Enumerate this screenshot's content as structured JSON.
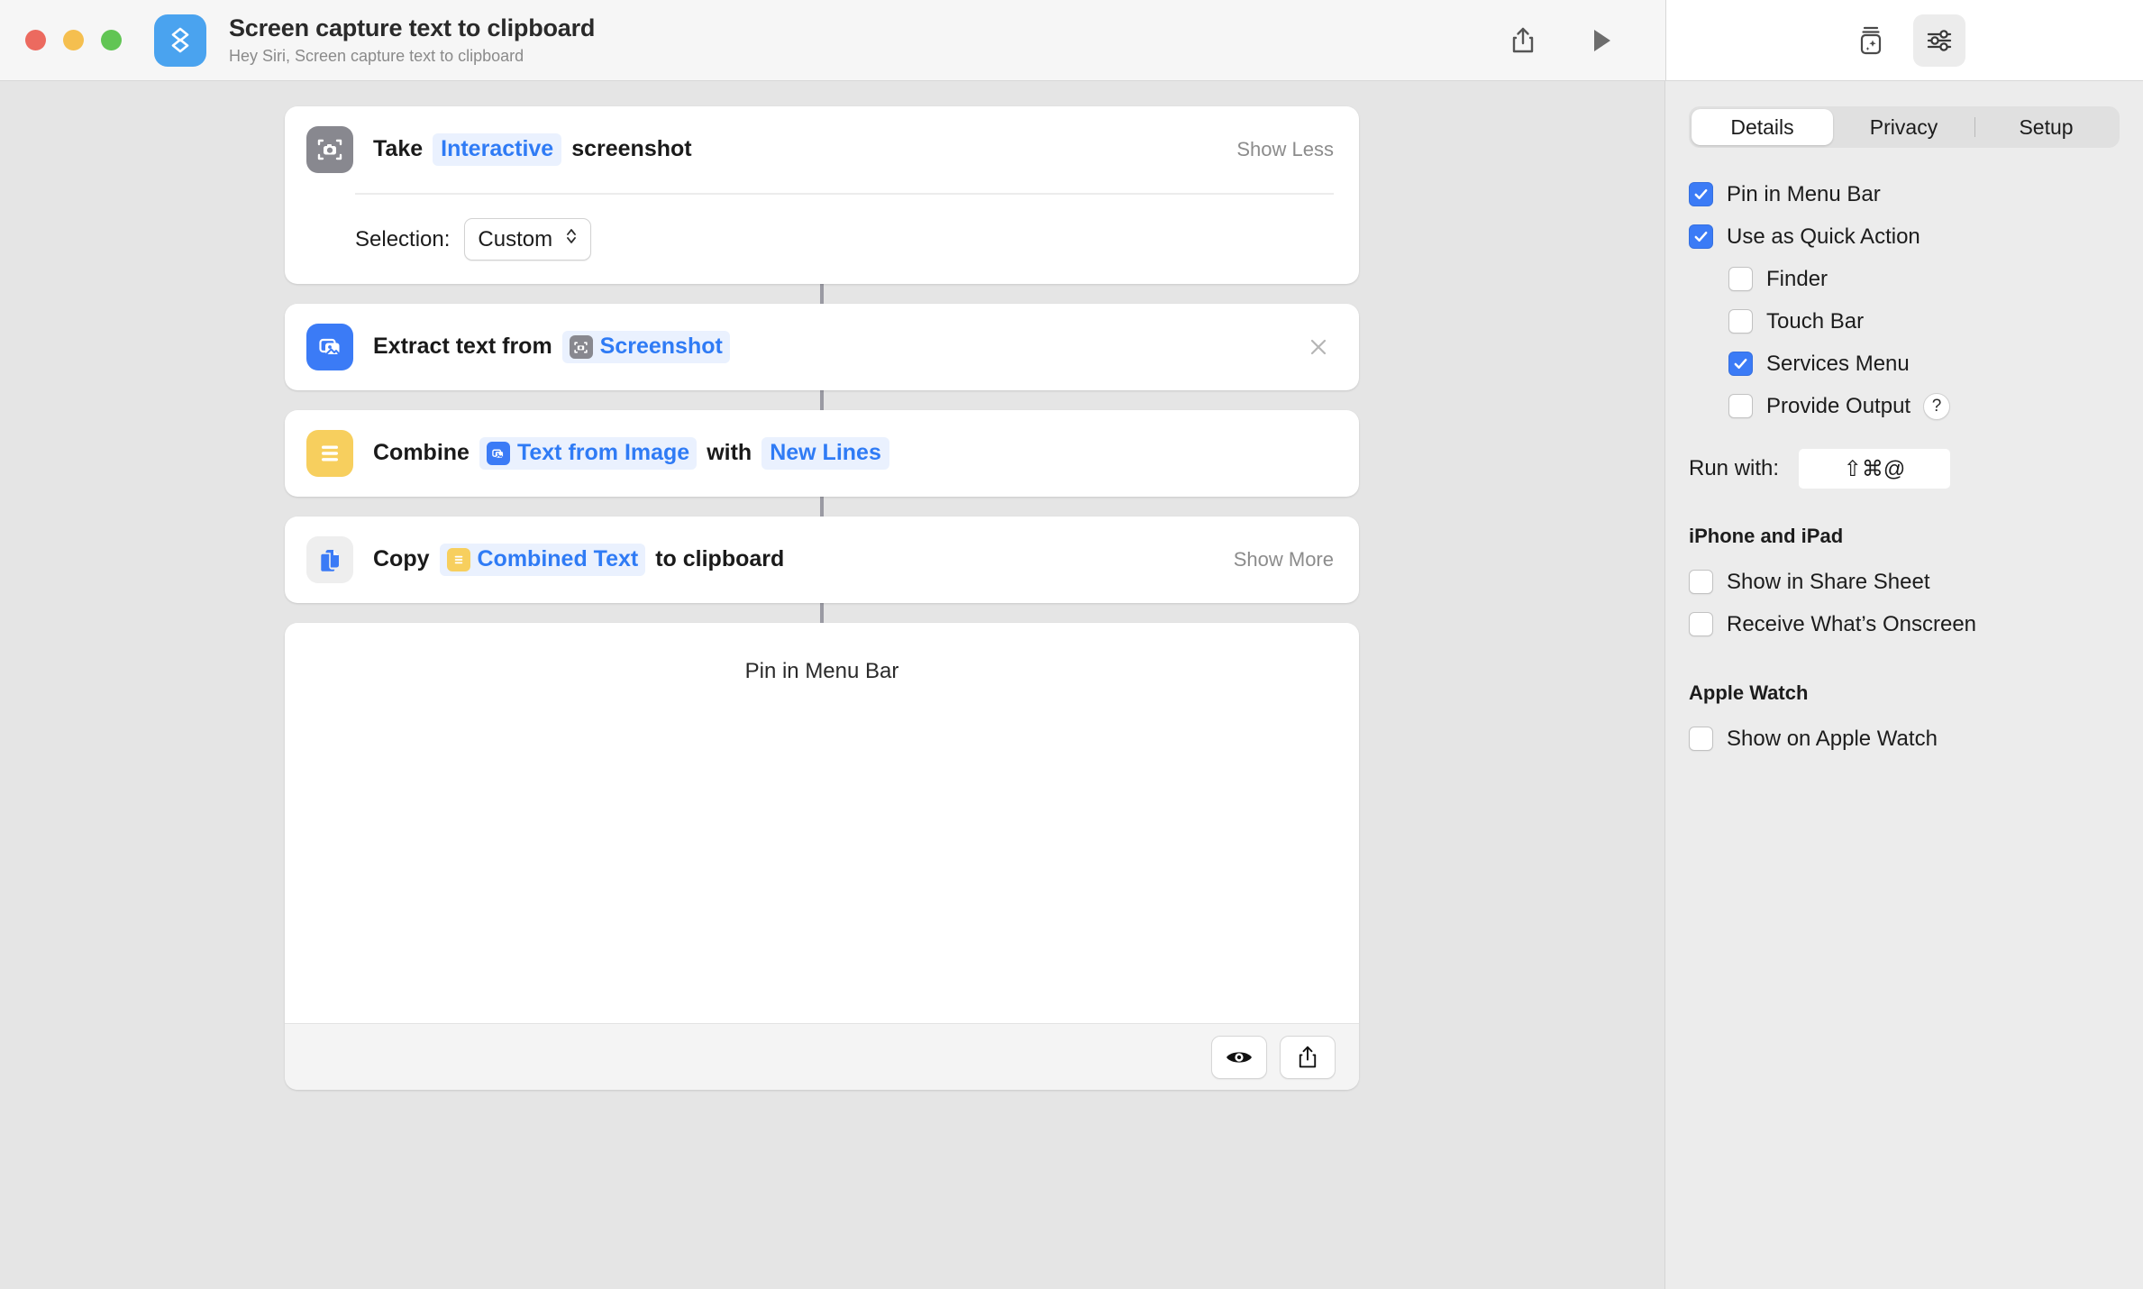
{
  "window": {
    "title": "Screen capture text to clipboard",
    "subtitle": "Hey Siri, Screen capture text to clipboard",
    "app_icon": "shortcuts-icon",
    "accent_blue": "#3b7bf6",
    "token_blue": "#2f7bf5",
    "canvas_bg": "#e5e5e5"
  },
  "toolbar": {
    "share_label": "share-icon",
    "play_label": "play-icon",
    "apps_label": "action-library-icon",
    "inspector_label": "shortcut-details-icon"
  },
  "actions": [
    {
      "icon": "screenshot-camera-icon",
      "icon_color": "#88888f",
      "words": [
        "Take"
      ],
      "token": "Interactive",
      "tail": "screenshot",
      "aux": "Show Less",
      "param_label": "Selection:",
      "param_value": "Custom"
    },
    {
      "icon": "extract-text-photo-icon",
      "icon_color": "#3b7bf6",
      "words": [
        "Extract text from"
      ],
      "token": "Screenshot",
      "token_chip": "screenshot-camera-icon",
      "aux": ""
    },
    {
      "icon": "text-lines-icon",
      "icon_color": "#f7cf5e",
      "words": [
        "Combine"
      ],
      "token": "Text from Image",
      "token_chip": "extract-text-photo-icon",
      "mid": "with",
      "token2": "New Lines",
      "aux": ""
    },
    {
      "icon": "copy-documents-icon",
      "icon_color": "#3b7bf6",
      "words": [
        "Copy"
      ],
      "token": "Combined Text",
      "token_chip": "text-lines-icon",
      "tail": "to clipboard",
      "aux": "Show More"
    }
  ],
  "preview": {
    "text": "Pin in Menu Bar",
    "eye_button": "quick-look-icon",
    "share_button": "share-icon"
  },
  "sidebar": {
    "tabs": [
      {
        "label": "Details",
        "active": true
      },
      {
        "label": "Privacy",
        "active": false
      },
      {
        "label": "Setup",
        "active": false
      }
    ],
    "options": [
      {
        "label": "Pin in Menu Bar",
        "checked": true,
        "indent": false
      },
      {
        "label": "Use as Quick Action",
        "checked": true,
        "indent": false
      },
      {
        "label": "Finder",
        "checked": false,
        "indent": true
      },
      {
        "label": "Touch Bar",
        "checked": false,
        "indent": true
      },
      {
        "label": "Services Menu",
        "checked": true,
        "indent": true
      },
      {
        "label": "Provide Output",
        "checked": false,
        "indent": true,
        "help": "?"
      }
    ],
    "run_with_label": "Run with:",
    "run_with_value": "⇧⌘@",
    "iphone_heading": "iPhone and iPad",
    "iphone_options": [
      {
        "label": "Show in Share Sheet",
        "checked": false
      },
      {
        "label": "Receive What’s Onscreen",
        "checked": false
      }
    ],
    "watch_heading": "Apple Watch",
    "watch_options": [
      {
        "label": "Show on Apple Watch",
        "checked": false
      }
    ]
  }
}
